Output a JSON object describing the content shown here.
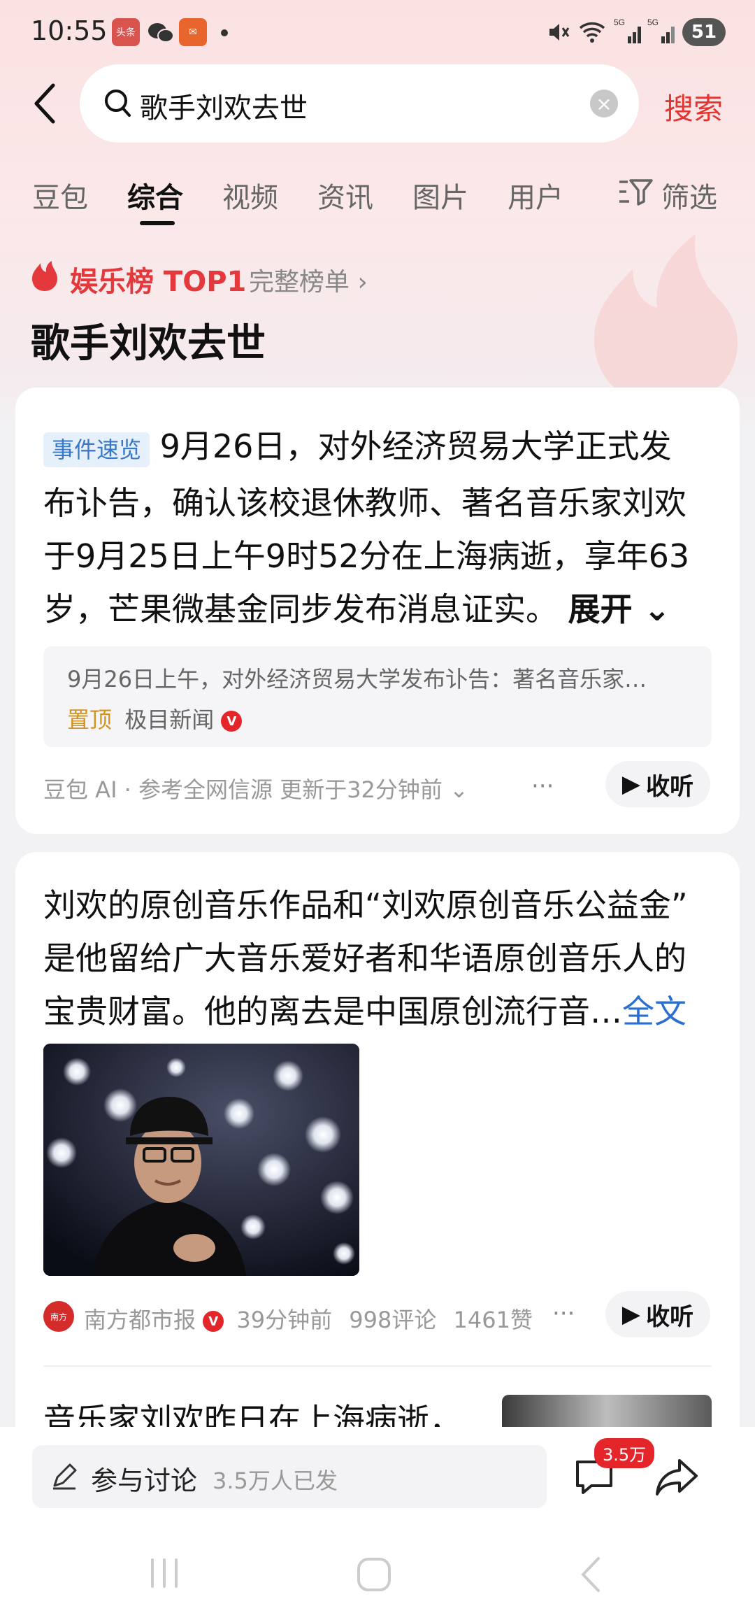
{
  "status_bar": {
    "time": "10:55",
    "battery": "51",
    "app_icon_1": "头条"
  },
  "search": {
    "query": "歌手刘欢去世",
    "button": "搜索"
  },
  "tabs": [
    "豆包",
    "综合",
    "视频",
    "资讯",
    "图片",
    "用户"
  ],
  "filter_label": "筛选",
  "banner": {
    "rank": "娱乐榜 TOP1",
    "full_list": "完整榜单",
    "title": "歌手刘欢去世"
  },
  "card1": {
    "tag": "事件速览",
    "lines": [
      "9月26日，对外经济贸易大学正式发",
      "布讣告，确认该校退休教师、著名音乐家刘欢",
      "于9月25日上午9时52分在上海病逝，享年63",
      "岁，芒果微基金同步发布消息证实。"
    ],
    "expand": "展开",
    "quote_text": "9月26日上午，对外经济贸易大学发布讣告：著名音乐家…",
    "pinned": "置顶",
    "quote_source": "极目新闻",
    "footer": "豆包 AI · 参考全网信源 更新于32分钟前",
    "listen": "收听"
  },
  "card2": {
    "lines": [
      "刘欢的原创音乐作品和“刘欢原创音乐公益金”",
      "是他留给广大音乐爱好者和华语原创音乐人的",
      "宝贵财富。他的离去是中国原创流行音…"
    ],
    "full_text": "全文",
    "source": "南方都市报",
    "time": "39分钟前",
    "comments": "998评论",
    "likes": "1461赞",
    "listen": "收听"
  },
  "card3": {
    "title_partial": "音乐家刘欢昨日在上海病逝，"
  },
  "bottom": {
    "discuss": "参与讨论",
    "discuss_count": "3.5万人已发",
    "comment_badge": "3.5万"
  },
  "colors": {
    "accent_red": "#e4393c",
    "link_blue": "#2a6fcf",
    "tag_blue": "#3978c6"
  }
}
